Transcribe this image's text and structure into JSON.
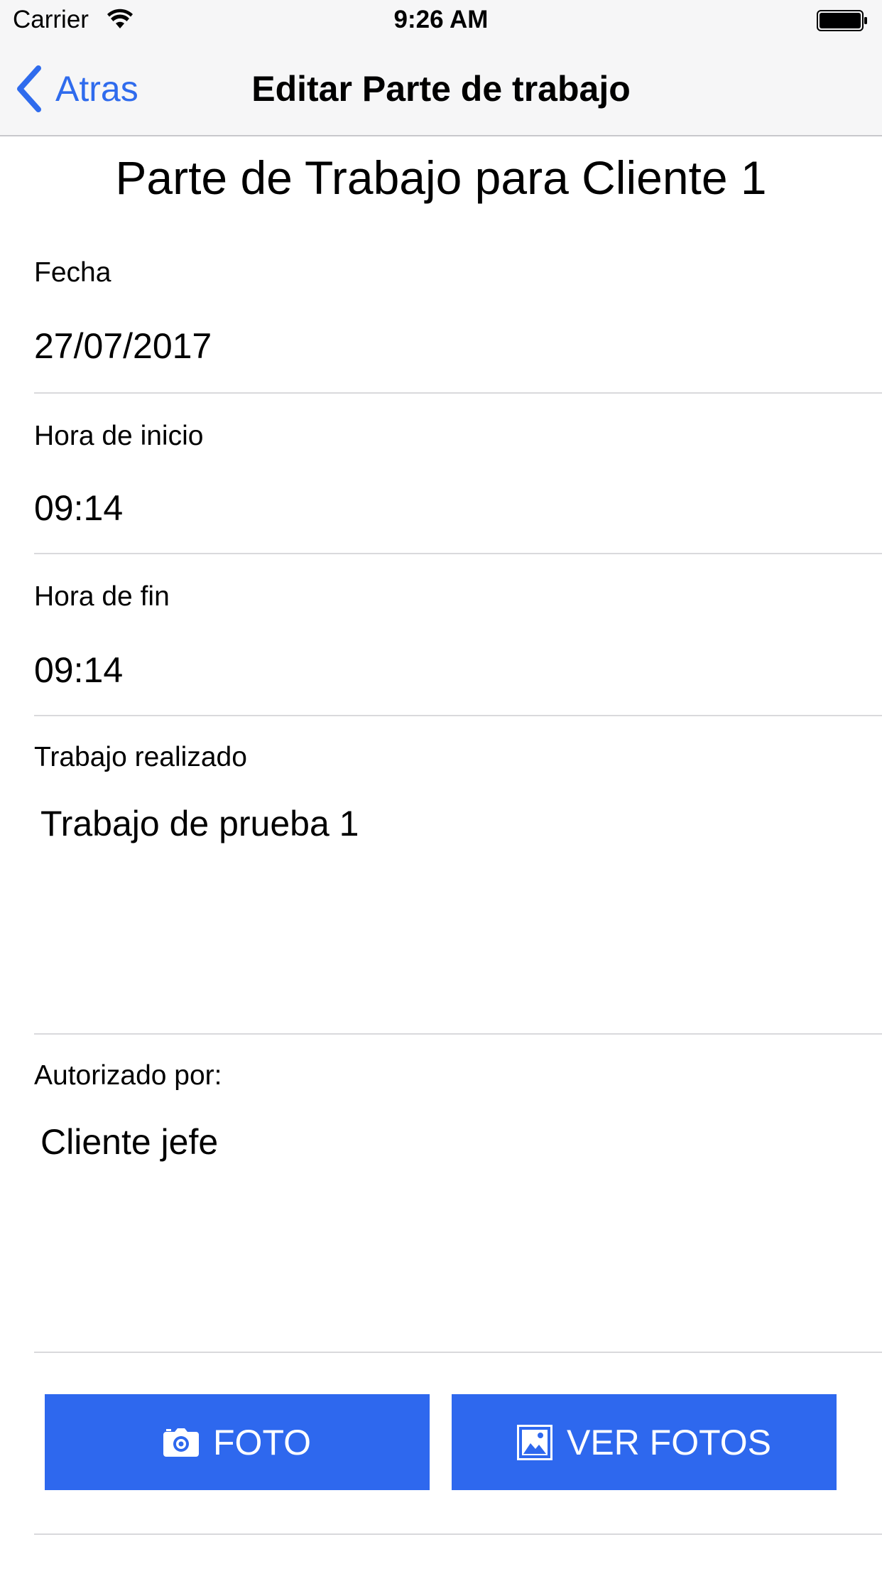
{
  "status_bar": {
    "carrier": "Carrier",
    "time": "9:26 AM",
    "icons": [
      "wifi-icon",
      "battery-icon"
    ]
  },
  "nav": {
    "back_label": "Atras",
    "title": "Editar Parte de trabajo",
    "icons": [
      "chevron-left-icon"
    ]
  },
  "form": {
    "heading": "Parte de Trabajo para Cliente 1",
    "fecha": {
      "label": "Fecha",
      "value": "27/07/2017"
    },
    "hora_inicio": {
      "label": "Hora de inicio",
      "value": "09:14"
    },
    "hora_fin": {
      "label": "Hora de fin",
      "value": "09:14"
    },
    "trabajo": {
      "label": "Trabajo realizado",
      "value": "Trabajo de prueba 1"
    },
    "autorizado": {
      "label": "Autorizado por:",
      "value": "Cliente jefe"
    }
  },
  "buttons": {
    "foto_label": "FOTO",
    "ver_fotos_label": "VER FOTOS",
    "icons": [
      "camera-icon",
      "image-icon"
    ]
  },
  "colors": {
    "accent": "#2f6bed",
    "button_bg": "#2e68ee",
    "bar_bg": "#f6f6f7"
  }
}
